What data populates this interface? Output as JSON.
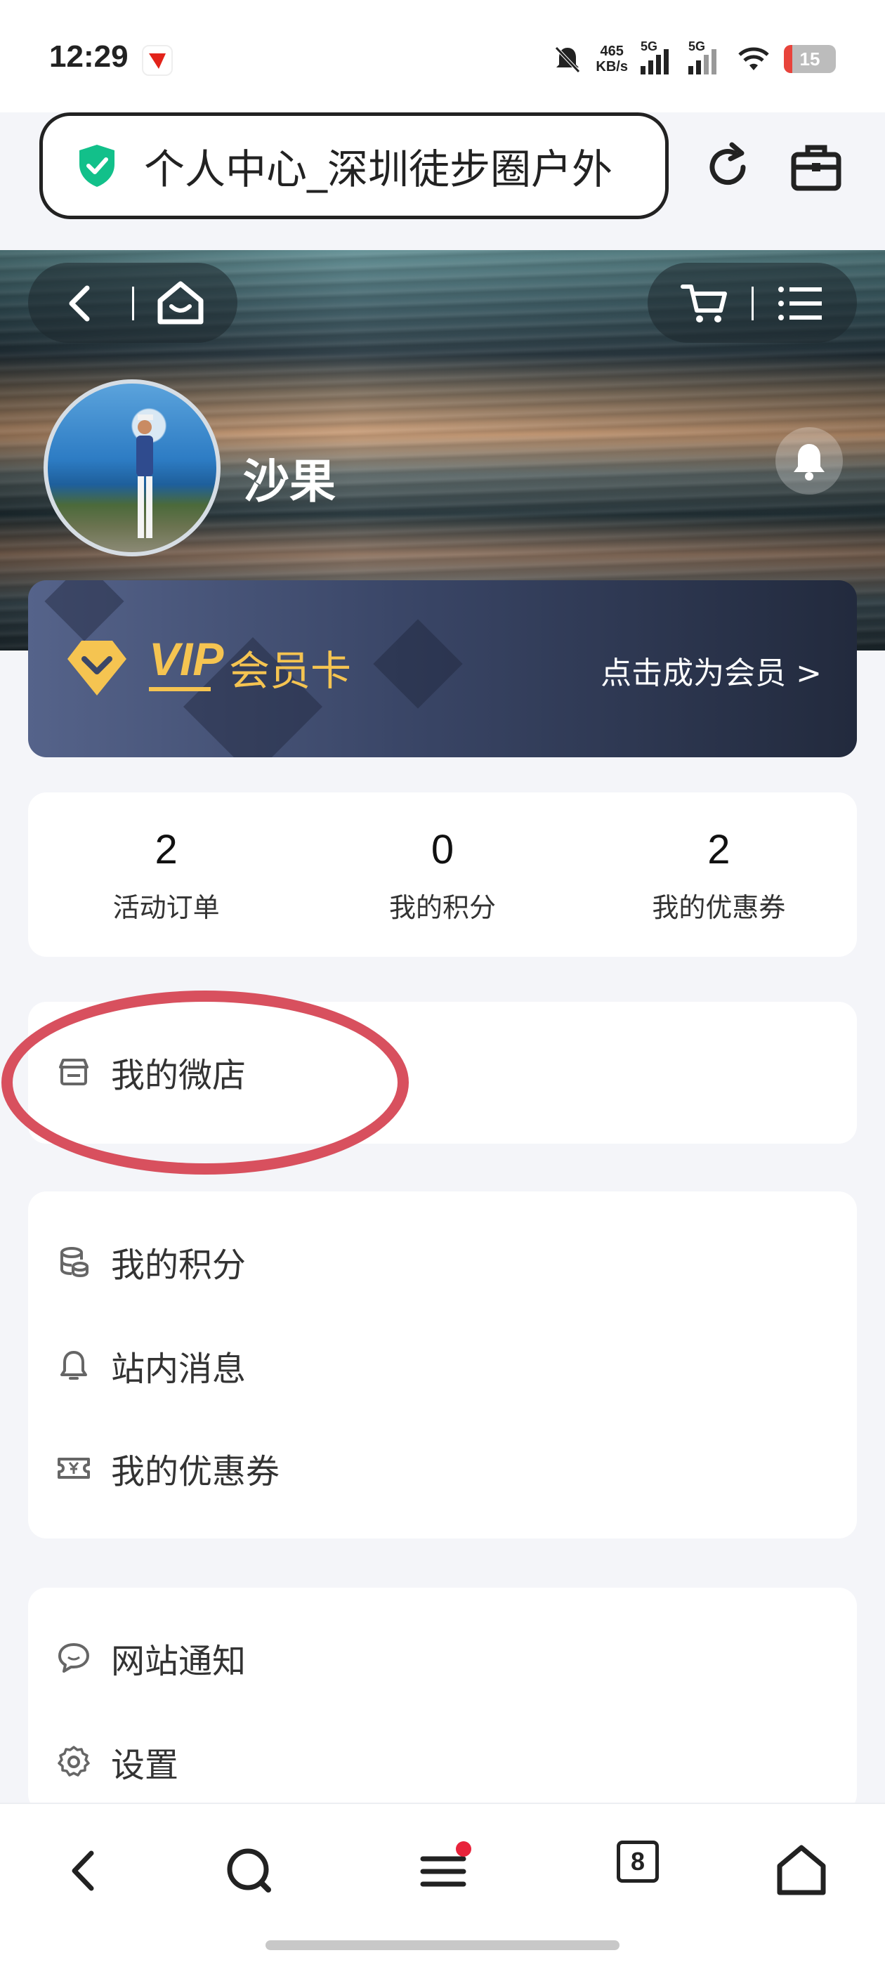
{
  "status_bar": {
    "time": "12:29",
    "net_speed_value": "465",
    "net_speed_unit": "KB/s",
    "sim1_label": "5G",
    "sim2_label": "5G",
    "battery": "15"
  },
  "browser": {
    "url_title": "个人中心_深圳徒步圈户外",
    "tab_count": "8"
  },
  "profile": {
    "user_name": "沙果"
  },
  "vip": {
    "badge_text": "VIP",
    "label": "会员卡",
    "cta": "点击成为会员 >"
  },
  "stats": [
    {
      "value": "2",
      "label": "活动订单"
    },
    {
      "value": "0",
      "label": "我的积分"
    },
    {
      "value": "2",
      "label": "我的优惠券"
    }
  ],
  "menu": {
    "shop": {
      "label": "我的微店",
      "icon": "store-icon"
    },
    "group1": [
      {
        "label": "我的积分",
        "icon": "coins-icon"
      },
      {
        "label": "站内消息",
        "icon": "bell-icon"
      },
      {
        "label": "我的优惠券",
        "icon": "coupon-icon"
      }
    ],
    "group2": [
      {
        "label": "网站通知",
        "icon": "chat-icon"
      },
      {
        "label": "设置",
        "icon": "gear-icon"
      }
    ]
  },
  "colors": {
    "vip_gold": "#f5c451",
    "annotation_red": "#d8505e",
    "secure_green": "#12c08a"
  }
}
